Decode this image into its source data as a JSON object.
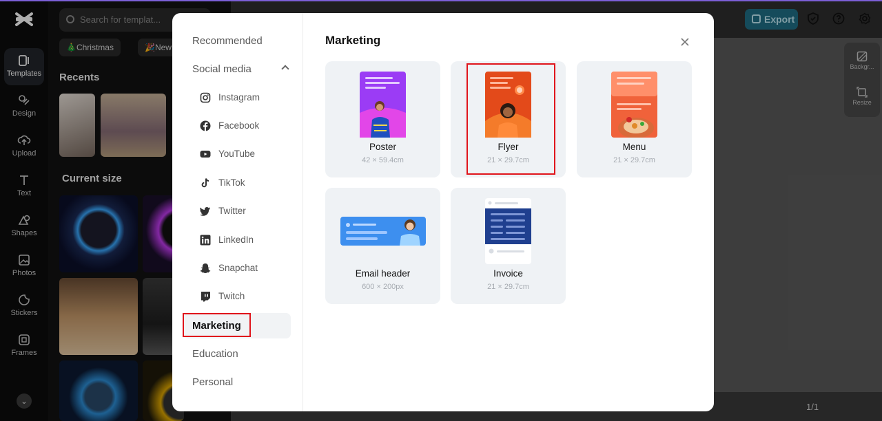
{
  "app": {
    "rail": [
      {
        "label": "Templates",
        "icon": "templates-icon"
      },
      {
        "label": "Design",
        "icon": "design-icon"
      },
      {
        "label": "Upload",
        "icon": "upload-icon"
      },
      {
        "label": "Text",
        "icon": "text-icon"
      },
      {
        "label": "Shapes",
        "icon": "shapes-icon"
      },
      {
        "label": "Photos",
        "icon": "photos-icon"
      },
      {
        "label": "Stickers",
        "icon": "stickers-icon"
      },
      {
        "label": "Frames",
        "icon": "frames-icon"
      }
    ],
    "search_placeholder": "Search for templat...",
    "chips": [
      "🎄Christmas",
      "🎉New Ye"
    ],
    "recents_title": "Recents",
    "current_size_title": "Current size",
    "export_label": "Export",
    "side_tools": [
      "Backgr...",
      "Resize"
    ],
    "page_indicator": "1/1"
  },
  "modal": {
    "nav": {
      "recommended": "Recommended",
      "social_media": "Social media",
      "social_items": [
        "Instagram",
        "Facebook",
        "YouTube",
        "TikTok",
        "Twitter",
        "LinkedIn",
        "Snapchat",
        "Twitch"
      ],
      "marketing": "Marketing",
      "education": "Education",
      "personal": "Personal"
    },
    "title": "Marketing",
    "cards": [
      {
        "name": "Poster",
        "size": "42 × 59.4cm"
      },
      {
        "name": "Flyer",
        "size": "21 × 29.7cm"
      },
      {
        "name": "Menu",
        "size": "21 × 29.7cm"
      },
      {
        "name": "Email header",
        "size": "600 × 200px"
      },
      {
        "name": "Invoice",
        "size": "21 × 29.7cm"
      }
    ]
  },
  "colors": {
    "highlight": "#e0141b",
    "export": "#1f6f86",
    "poster": "#9b3cf5",
    "flyer": "#e34a1a",
    "menu": "#f0623a",
    "email": "#3d8fef",
    "invoice": "#1f3f8f"
  }
}
